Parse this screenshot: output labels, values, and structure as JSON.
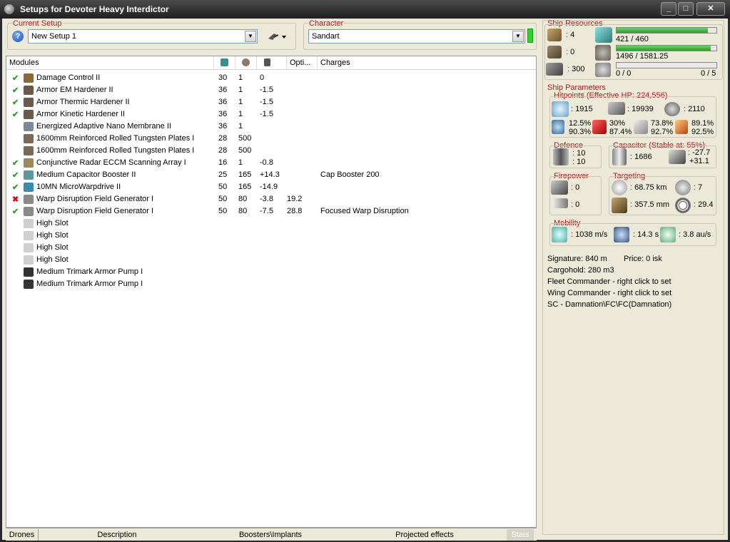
{
  "window": {
    "title": "Setups for Devoter Heavy Interdictor",
    "min": "_",
    "max": "□",
    "close": "✕"
  },
  "current_setup": {
    "label": "Current Setup",
    "value": "New Setup 1",
    "help": "?"
  },
  "character": {
    "label": "Character",
    "value": "Sandart"
  },
  "modules": {
    "headers": {
      "name": "Modules",
      "opt": "Opti...",
      "charges": "Charges"
    },
    "rows": [
      {
        "check": "✔",
        "name": "Damage Control II",
        "cpu": "30",
        "pg": "1",
        "cap": "0",
        "opt": "",
        "charge": ""
      },
      {
        "check": "✔",
        "name": "Armor EM Hardener II",
        "cpu": "36",
        "pg": "1",
        "cap": "-1.5",
        "opt": "",
        "charge": ""
      },
      {
        "check": "✔",
        "name": "Armor Thermic Hardener II",
        "cpu": "36",
        "pg": "1",
        "cap": "-1.5",
        "opt": "",
        "charge": ""
      },
      {
        "check": "✔",
        "name": "Armor Kinetic Hardener II",
        "cpu": "36",
        "pg": "1",
        "cap": "-1.5",
        "opt": "",
        "charge": ""
      },
      {
        "check": "",
        "name": "Energized Adaptive Nano Membrane II",
        "cpu": "36",
        "pg": "1",
        "cap": "",
        "opt": "",
        "charge": ""
      },
      {
        "check": "",
        "name": "1600mm Reinforced Rolled Tungsten Plates I",
        "cpu": "28",
        "pg": "500",
        "cap": "",
        "opt": "",
        "charge": ""
      },
      {
        "check": "",
        "name": "1600mm Reinforced Rolled Tungsten Plates I",
        "cpu": "28",
        "pg": "500",
        "cap": "",
        "opt": "",
        "charge": ""
      },
      {
        "check": "✔",
        "name": "Conjunctive Radar ECCM Scanning Array I",
        "cpu": "16",
        "pg": "1",
        "cap": "-0.8",
        "opt": "",
        "charge": ""
      },
      {
        "check": "✔",
        "name": "Medium Capacitor Booster II",
        "cpu": "25",
        "pg": "165",
        "cap": "+14.3",
        "opt": "",
        "charge": "Cap Booster 200"
      },
      {
        "check": "✔",
        "name": "10MN MicroWarpdrive II",
        "cpu": "50",
        "pg": "165",
        "cap": "-14.9",
        "opt": "",
        "charge": ""
      },
      {
        "check": "✖",
        "name": "Warp Disruption Field Generator I",
        "cpu": "50",
        "pg": "80",
        "cap": "-3.8",
        "opt": "19.2",
        "charge": ""
      },
      {
        "check": "✔",
        "name": "Warp Disruption Field Generator I",
        "cpu": "50",
        "pg": "80",
        "cap": "-7.5",
        "opt": "28.8",
        "charge": "Focused Warp Disruption"
      },
      {
        "check": "",
        "name": "High Slot",
        "cpu": "",
        "pg": "",
        "cap": "",
        "opt": "",
        "charge": ""
      },
      {
        "check": "",
        "name": "High Slot",
        "cpu": "",
        "pg": "",
        "cap": "",
        "opt": "",
        "charge": ""
      },
      {
        "check": "",
        "name": "High Slot",
        "cpu": "",
        "pg": "",
        "cap": "",
        "opt": "",
        "charge": ""
      },
      {
        "check": "",
        "name": "High Slot",
        "cpu": "",
        "pg": "",
        "cap": "",
        "opt": "",
        "charge": ""
      },
      {
        "check": "",
        "name": "Medium Trimark Armor Pump I",
        "cpu": "",
        "pg": "",
        "cap": "",
        "opt": "",
        "charge": ""
      },
      {
        "check": "",
        "name": "Medium Trimark Armor Pump I",
        "cpu": "",
        "pg": "",
        "cap": "",
        "opt": "",
        "charge": ""
      }
    ]
  },
  "tabs": {
    "drones": "Drones",
    "description": "Description",
    "boosters": "Boosters\\Implants",
    "projected": "Projected effects",
    "stats": "Stats"
  },
  "resources": {
    "label": "Ship Resources",
    "hardpoints": ": 4",
    "turret_free": ": 0",
    "calibration": ": 300",
    "cpu_text": "421 / 460",
    "cpu_fill": 0.915,
    "pg_text": "1496 / 1581.25",
    "pg_fill": 0.946,
    "drone_text": "0 / 0",
    "drone_right": "0 / 5",
    "drone_fill": 0
  },
  "params": {
    "label": "Ship Parameters",
    "hitpoints_label": "Hitpoints (Effective HP: 224,556)",
    "shield": ": 1915",
    "armor": ": 19939",
    "structure": ": 2110",
    "res": [
      [
        "12.5%",
        "90.3%"
      ],
      [
        "30%",
        "87.4%"
      ],
      [
        "73.8%",
        "92.7%"
      ],
      [
        "89.1%",
        "92.5%"
      ]
    ],
    "defence_label": "Defence",
    "def1": ": 10",
    "def2": ": 10",
    "capacitor_label": "Capacitor (Stable at: 55%)",
    "cap_amount": ": 1686",
    "cap_a": ": -27.7",
    "cap_b": "+31.1",
    "firepower_label": "Firepower",
    "fp1": ": 0",
    "fp2": ": 0",
    "targeting_label": "Targeting",
    "range": ": 68.75 km",
    "max_targets": ": 7",
    "scan_res": ": 357.5 mm",
    "sensor": ": 29.4",
    "mobility_label": "Mobility",
    "velocity": ": 1038 m/s",
    "align": ": 14.3 s",
    "warp": ": 3.8 au/s"
  },
  "info": {
    "signature": "Signature: 840 m",
    "price": "Price: 0 isk",
    "cargo": "Cargohold: 280 m3",
    "fleet": "Fleet Commander - right click to set",
    "wing": "Wing Commander - right click to set",
    "sc": "SC - Damnation\\FC\\FC(Damnation)"
  }
}
